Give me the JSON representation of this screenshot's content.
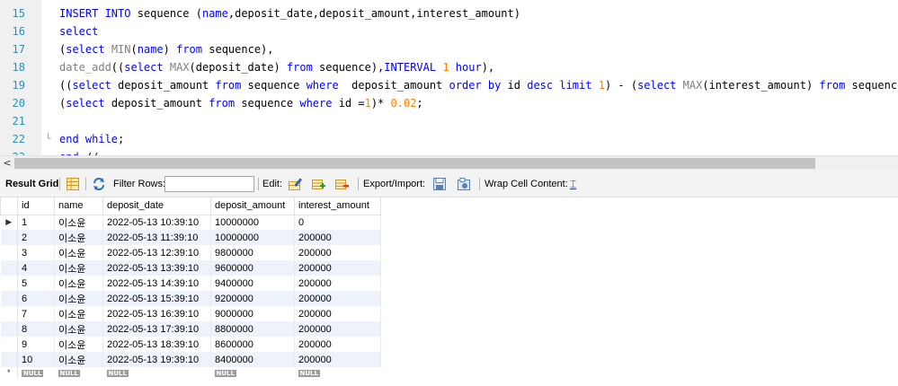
{
  "editor": {
    "lines": [
      {
        "num": "15",
        "fold": "",
        "tokens": [
          {
            "t": "kw",
            "v": "INSERT INTO"
          },
          {
            "t": "id",
            "v": " sequence ("
          },
          {
            "t": "kw",
            "v": "name"
          },
          {
            "t": "id",
            "v": ",deposit_date,deposit_amount,interest_amount)"
          }
        ]
      },
      {
        "num": "16",
        "fold": "",
        "tokens": [
          {
            "t": "kw",
            "v": "select"
          }
        ]
      },
      {
        "num": "17",
        "fold": "",
        "tokens": [
          {
            "t": "id",
            "v": "("
          },
          {
            "t": "kw",
            "v": "select"
          },
          {
            "t": "id",
            "v": " "
          },
          {
            "t": "fn",
            "v": "MIN"
          },
          {
            "t": "id",
            "v": "("
          },
          {
            "t": "kw",
            "v": "name"
          },
          {
            "t": "id",
            "v": ") "
          },
          {
            "t": "kw",
            "v": "from"
          },
          {
            "t": "id",
            "v": " sequence),"
          }
        ]
      },
      {
        "num": "18",
        "fold": "",
        "tokens": [
          {
            "t": "fn",
            "v": "date_add"
          },
          {
            "t": "id",
            "v": "(("
          },
          {
            "t": "kw",
            "v": "select"
          },
          {
            "t": "id",
            "v": " "
          },
          {
            "t": "fn",
            "v": "MAX"
          },
          {
            "t": "id",
            "v": "(deposit_date) "
          },
          {
            "t": "kw",
            "v": "from"
          },
          {
            "t": "id",
            "v": " sequence),"
          },
          {
            "t": "kw",
            "v": "INTERVAL"
          },
          {
            "t": "id",
            "v": " "
          },
          {
            "t": "num",
            "v": "1"
          },
          {
            "t": "id",
            "v": " "
          },
          {
            "t": "kw",
            "v": "hour"
          },
          {
            "t": "id",
            "v": "),"
          }
        ]
      },
      {
        "num": "19",
        "fold": "",
        "tokens": [
          {
            "t": "id",
            "v": "(("
          },
          {
            "t": "kw",
            "v": "select"
          },
          {
            "t": "id",
            "v": " deposit_amount "
          },
          {
            "t": "kw",
            "v": "from"
          },
          {
            "t": "id",
            "v": " sequence "
          },
          {
            "t": "kw",
            "v": "where"
          },
          {
            "t": "id",
            "v": "  deposit_amount "
          },
          {
            "t": "kw",
            "v": "order by"
          },
          {
            "t": "id",
            "v": " id "
          },
          {
            "t": "kw",
            "v": "desc limit"
          },
          {
            "t": "id",
            "v": " "
          },
          {
            "t": "num",
            "v": "1"
          },
          {
            "t": "id",
            "v": ") - ("
          },
          {
            "t": "kw",
            "v": "select"
          },
          {
            "t": "id",
            "v": " "
          },
          {
            "t": "fn",
            "v": "MAX"
          },
          {
            "t": "id",
            "v": "(interest_amount) "
          },
          {
            "t": "kw",
            "v": "from"
          },
          {
            "t": "id",
            "v": " sequence)),"
          }
        ]
      },
      {
        "num": "20",
        "fold": "",
        "tokens": [
          {
            "t": "id",
            "v": "("
          },
          {
            "t": "kw",
            "v": "select"
          },
          {
            "t": "id",
            "v": " deposit_amount "
          },
          {
            "t": "kw",
            "v": "from"
          },
          {
            "t": "id",
            "v": " sequence "
          },
          {
            "t": "kw",
            "v": "where"
          },
          {
            "t": "id",
            "v": " id ="
          },
          {
            "t": "num",
            "v": "1"
          },
          {
            "t": "id",
            "v": ")* "
          },
          {
            "t": "num",
            "v": "0.02"
          },
          {
            "t": "id",
            "v": ";"
          }
        ]
      },
      {
        "num": "21",
        "fold": "",
        "tokens": []
      },
      {
        "num": "22",
        "fold": "└",
        "tokens": [
          {
            "t": "kw",
            "v": "end while"
          },
          {
            "t": "id",
            "v": ";"
          }
        ]
      },
      {
        "num": "23",
        "fold": "",
        "tokens": [
          {
            "t": "kw",
            "v": "end"
          },
          {
            "t": "id",
            "v": " //"
          }
        ]
      }
    ]
  },
  "scrollbar": {
    "left_arrow": "<"
  },
  "toolbar": {
    "result_grid_label": "Result Grid",
    "filter_rows_label": "Filter Rows:",
    "filter_value": "",
    "edit_label": "Edit:",
    "export_import_label": "Export/Import:",
    "wrap_cell_label": "Wrap Cell Content:",
    "wrap_icon_glyph": "⌶"
  },
  "grid": {
    "columns": [
      "id",
      "name",
      "deposit_date",
      "deposit_amount",
      "interest_amount"
    ],
    "rows": [
      [
        "1",
        "이소윤",
        "2022-05-13 10:39:10",
        "10000000",
        "0"
      ],
      [
        "2",
        "이소윤",
        "2022-05-13 11:39:10",
        "10000000",
        "200000"
      ],
      [
        "3",
        "이소윤",
        "2022-05-13 12:39:10",
        "9800000",
        "200000"
      ],
      [
        "4",
        "이소윤",
        "2022-05-13 13:39:10",
        "9600000",
        "200000"
      ],
      [
        "5",
        "이소윤",
        "2022-05-13 14:39:10",
        "9400000",
        "200000"
      ],
      [
        "6",
        "이소윤",
        "2022-05-13 15:39:10",
        "9200000",
        "200000"
      ],
      [
        "7",
        "이소윤",
        "2022-05-13 16:39:10",
        "9000000",
        "200000"
      ],
      [
        "8",
        "이소윤",
        "2022-05-13 17:39:10",
        "8800000",
        "200000"
      ],
      [
        "9",
        "이소윤",
        "2022-05-13 18:39:10",
        "8600000",
        "200000"
      ],
      [
        "10",
        "이소윤",
        "2022-05-13 19:39:10",
        "8400000",
        "200000"
      ]
    ],
    "null_label": "NULL",
    "current_row_marker": "▶",
    "new_row_marker": "*"
  },
  "colors": {
    "keyword": "#0000ff",
    "function": "#808080",
    "number": "#ff7f00",
    "line_number": "#2b91af",
    "alt_row": "#eef3fb"
  }
}
